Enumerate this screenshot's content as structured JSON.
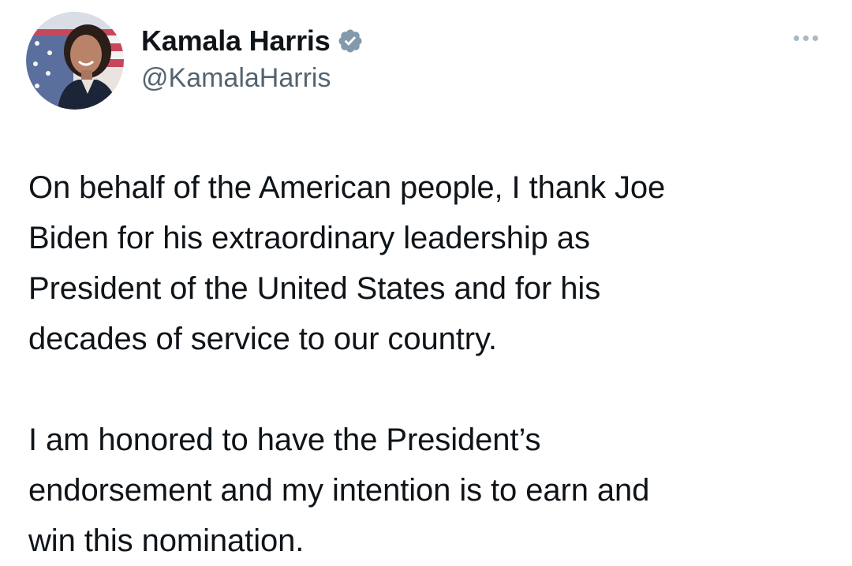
{
  "author": {
    "display_name": "Kamala Harris",
    "handle": "@KamalaHarris",
    "verified": true,
    "verified_color": "#829aab",
    "avatar": "profile-photo"
  },
  "menu": {
    "icon": "more-horizontal-icon"
  },
  "tweet": {
    "paragraphs": [
      "On behalf of the American people, I thank Joe\nBiden for his extraordinary leadership as\nPresident of the United States and for his\ndecades of service to our country.",
      "I am honored to have the President’s\nendorsement and my intention is to earn and\nwin this nomination."
    ]
  }
}
